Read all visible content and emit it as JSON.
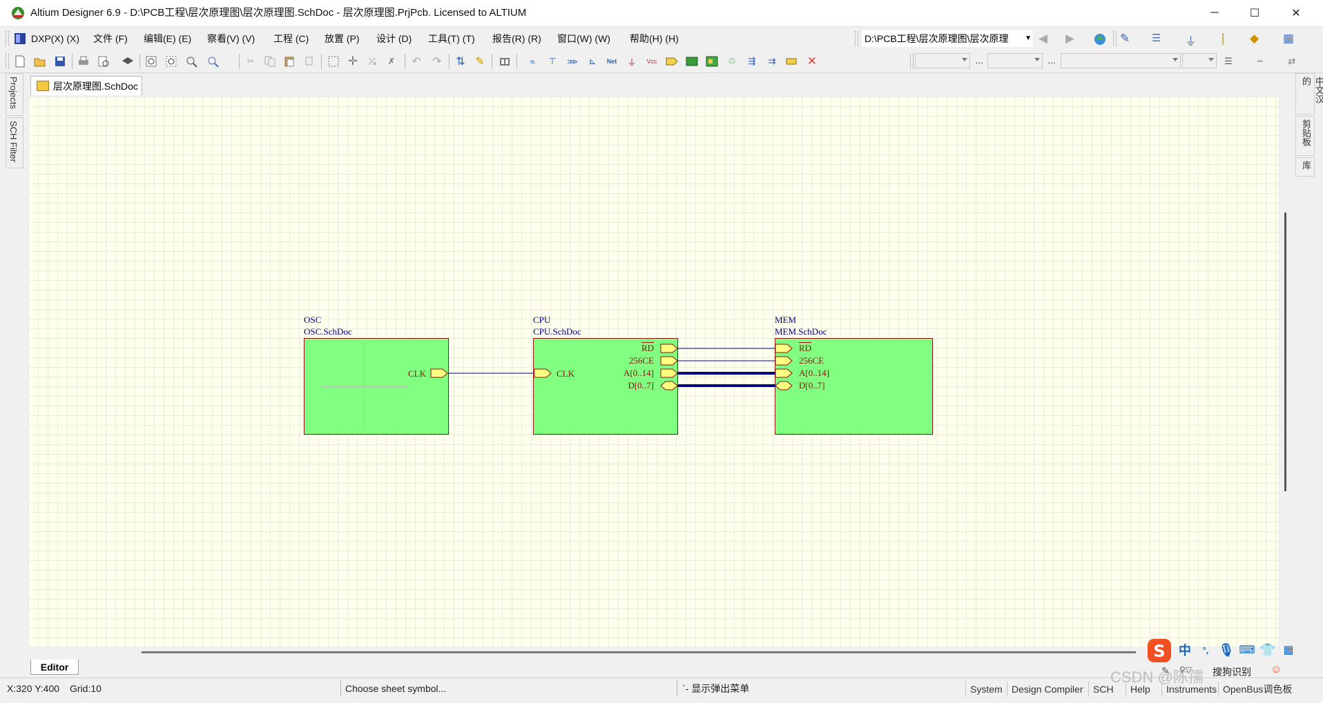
{
  "window": {
    "title": "Altium Designer 6.9 - D:\\PCB工程\\层次原理图\\层次原理图.SchDoc - 层次原理图.PrjPcb. Licensed to ALTIUM",
    "minimize": "─",
    "maximize": "☐",
    "close": "✕"
  },
  "menu": {
    "items": [
      "DXP(X) (X)",
      "文件 (F)",
      "编辑(E) (E)",
      "察看(V) (V)",
      "工程 (C)",
      "放置 (P)",
      "设计 (D)",
      "工具(T) (T)",
      "报告(R) (R)",
      "窗口(W) (W)",
      "帮助(H) (H)"
    ],
    "project_path": "D:\\PCB工程\\层次原理图\\层次原理"
  },
  "toolbar": {
    "icons": [
      "new-icon",
      "open-icon",
      "save-icon",
      "print-icon",
      "print-preview-icon",
      "layers-icon",
      "zoom-fit-icon",
      "zoom-area-icon",
      "zoom-select-icon",
      "zoom-filter-icon",
      "cut-icon",
      "copy-icon",
      "paste-icon",
      "rubber-stamp-icon",
      "select-area-icon",
      "move-icon",
      "cross-select-icon",
      "clear-selection-icon",
      "undo-icon",
      "redo-icon",
      "hierarchy-icon",
      "probe-icon",
      "library-icon",
      "wire-icon",
      "bus-icon",
      "bus-entry-icon",
      "net-label-icon",
      "net-icon",
      "gnd-icon",
      "vcc-icon",
      "part-icon",
      "sheet-symbol-icon",
      "sheet-entry-icon",
      "device-sheet-icon",
      "port-icon",
      "off-sheet-icon",
      "no-erc-icon"
    ]
  },
  "left_panels": [
    "Projects",
    "SCH Filter"
  ],
  "right_panels": [
    "中文汉的",
    "剪贴板",
    "库"
  ],
  "document_tab": "层次原理图.SchDoc",
  "schematic": {
    "sheets": [
      {
        "designator": "OSC",
        "filename": "OSC.SchDoc",
        "entries_right": [
          "CLK"
        ]
      },
      {
        "designator": "CPU",
        "filename": "CPU.SchDoc",
        "entries_left": [
          "CLK"
        ],
        "entries_right": [
          "RD",
          "256CE",
          "A[0..14]",
          "D[0..7]"
        ]
      },
      {
        "designator": "MEM",
        "filename": "MEM.SchDoc",
        "entries_left": [
          "RD",
          "256CE",
          "A[0..14]",
          "D[0..7]"
        ]
      }
    ],
    "colors": {
      "sheet_fill": "#80ff80",
      "sheet_border": "#8b1010",
      "wire": "#000080",
      "bus": "#000080",
      "entry_fill": "#ffff80"
    }
  },
  "bottom": {
    "editor_tab": "Editor"
  },
  "status": {
    "coords": "X:320 Y:400",
    "grid": "Grid:10",
    "message": "Choose sheet symbol...",
    "hint": "`- 显示弹出菜单",
    "tabs": [
      "System",
      "Design Compiler",
      "SCH",
      "Help",
      "Instruments",
      "OpenBus调色板"
    ]
  },
  "ime": {
    "lang": "中",
    "punct": "°,",
    "toolbox": "搜狗识别"
  },
  "watermark": "CSDN @陈孺"
}
